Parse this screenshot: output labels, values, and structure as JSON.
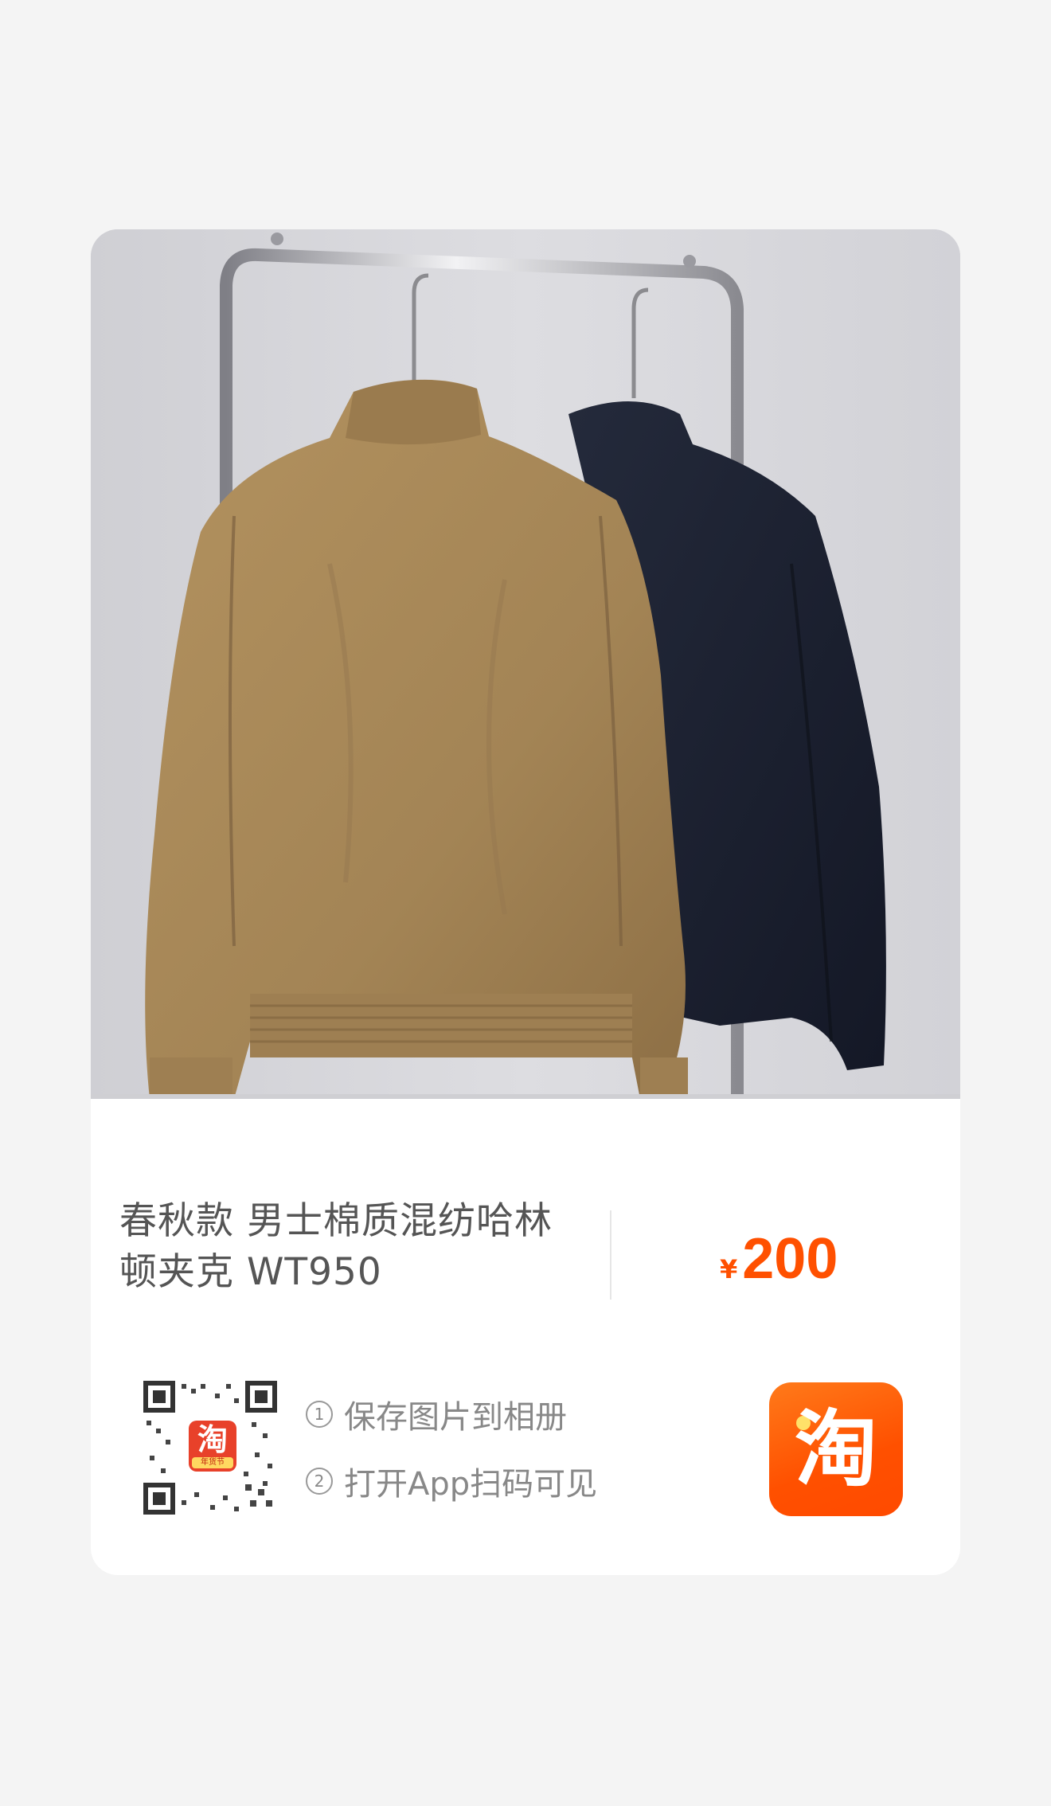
{
  "product": {
    "image_alt": "两件挂在衣架上的哈林顿夹克（卡其色与藏青色）",
    "title": "春秋款 男士棉质混纺哈林顿夹克 WT950",
    "currency_symbol": "¥",
    "price": "200"
  },
  "qr": {
    "badge_glyph": "淘",
    "badge_caption": "年货节"
  },
  "steps": [
    {
      "num": "1",
      "text": "保存图片到相册"
    },
    {
      "num": "2",
      "text": "打开App扫码可见"
    }
  ],
  "app_button": {
    "glyph": "淘",
    "icon": "taobao-logo-icon"
  },
  "colors": {
    "accent": "#ff5000",
    "jacket_khaki": "#a8875a",
    "jacket_navy": "#1c2233",
    "background": "#f4f4f4"
  }
}
